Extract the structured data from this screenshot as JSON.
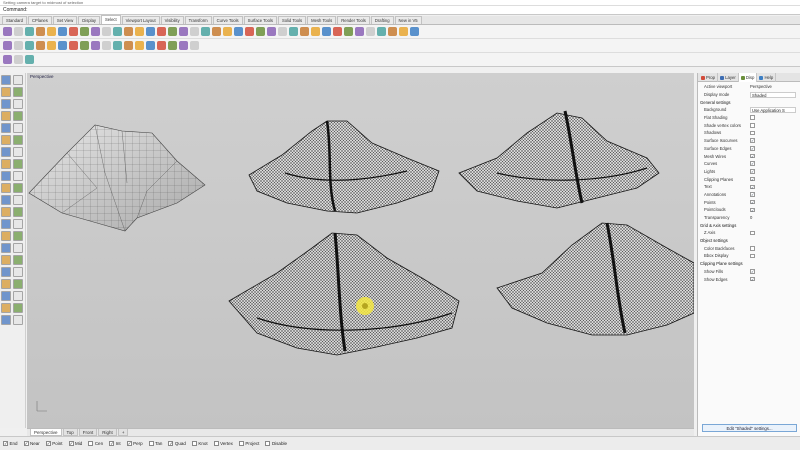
{
  "command": {
    "history": "Setting camera target to midmost of selection",
    "label": "Command:",
    "value": ""
  },
  "tabs": [
    {
      "label": "Standard"
    },
    {
      "label": "CPlanes"
    },
    {
      "label": "Set View"
    },
    {
      "label": "Display"
    },
    {
      "label": "Select",
      "active": true
    },
    {
      "label": "Viewport Layout"
    },
    {
      "label": "Visibility"
    },
    {
      "label": "Transform"
    },
    {
      "label": "Curve Tools"
    },
    {
      "label": "Surface Tools"
    },
    {
      "label": "Solid Tools"
    },
    {
      "label": "Mesh Tools"
    },
    {
      "label": "Render Tools"
    },
    {
      "label": "Drafting"
    },
    {
      "label": "New in V5"
    }
  ],
  "toolbar_icons": {
    "row1": [
      "new-icon",
      "open-icon",
      "save-icon",
      "print-icon",
      "cut-icon",
      "copy-icon",
      "paste-icon",
      "undo-icon",
      "redo-icon",
      "pan-icon",
      "rotate-view-icon",
      "zoom-icon",
      "zoom-window-icon",
      "zoom-extents-icon",
      "zoom-selected-icon",
      "four-views-icon",
      "cplane-icon",
      "perspective-icon",
      "wireframe-icon",
      "shaded-icon",
      "rendered-icon",
      "ghosted-icon",
      "lights-icon",
      "layers-icon",
      "object-properties-icon",
      "select-all-icon",
      "select-none-icon",
      "invert-selection-icon",
      "select-previous-icon",
      "select-curves-icon",
      "select-surfaces-icon",
      "select-polysurfaces-icon",
      "select-meshes-icon",
      "select-points-icon",
      "select-lights-icon",
      "options-icon",
      "grid-icon",
      "help-icon"
    ],
    "row2": [
      "sphere-icon",
      "box-icon",
      "cylinder-icon",
      "cone-icon",
      "torus-icon",
      "extrude-icon",
      "loft-icon",
      "sweep-icon",
      "revolve-icon",
      "network-icon",
      "patch-icon",
      "blend-icon",
      "boolean-union-icon",
      "boolean-difference-icon",
      "mesh-icon",
      "render-icon",
      "material-icon",
      "environment-icon"
    ],
    "row3": [
      "snap-icon",
      "ortho-icon",
      "planar-icon"
    ]
  },
  "left_tools": [
    "select-icon",
    "point-icon",
    "line-icon",
    "polyline-icon",
    "curve-icon",
    "arc-icon",
    "circle-icon",
    "ellipse-icon",
    "rectangle-icon",
    "polygon-icon",
    "fillet-curve-icon",
    "offset-icon",
    "surface-icon",
    "extrude-icon",
    "solid-box-icon",
    "sphere-icon",
    "mesh-icon",
    "boolean-icon",
    "text-icon",
    "dimension-icon",
    "move-icon",
    "copy-icon",
    "rotate-icon",
    "scale-icon",
    "mirror-icon",
    "array-icon",
    "trim-icon",
    "split-icon",
    "join-icon",
    "explode-icon",
    "group-icon",
    "block-icon",
    "analyze-icon",
    "render-icon",
    "layer-icon",
    "properties-icon",
    "snapshot-icon",
    "osnap-icon",
    "history-icon",
    "gumball-icon",
    "cplane-icon",
    "zoom-icon"
  ],
  "viewport": {
    "title": "Perspective",
    "view_tabs": [
      {
        "label": "Perspective",
        "active": true
      },
      {
        "label": "Top"
      },
      {
        "label": "Front"
      },
      {
        "label": "Right"
      },
      {
        "label": "+"
      }
    ]
  },
  "osnaps": [
    {
      "label": "End",
      "checked": true
    },
    {
      "label": "Near",
      "checked": true
    },
    {
      "label": "Point",
      "checked": true
    },
    {
      "label": "Mid",
      "checked": true
    },
    {
      "label": "Cen",
      "checked": false
    },
    {
      "label": "Int",
      "checked": true
    },
    {
      "label": "Perp",
      "checked": true
    },
    {
      "label": "Tan",
      "checked": false
    },
    {
      "label": "Quad",
      "checked": true
    },
    {
      "label": "Knot",
      "checked": false
    },
    {
      "label": "Vertex",
      "checked": false
    },
    {
      "label": "Project",
      "checked": false
    },
    {
      "label": "Disable",
      "checked": false
    }
  ],
  "panel": {
    "tabs": [
      {
        "label": "Prop",
        "color": "#d24b3a"
      },
      {
        "label": "Layer",
        "color": "#3d6db3"
      },
      {
        "label": "Disp",
        "color": "#6a8f3a",
        "active": true
      },
      {
        "label": "Help",
        "color": "#3d7fc4"
      }
    ],
    "rows": [
      {
        "type": "kv",
        "k": "Active viewport",
        "v": "Perspective"
      },
      {
        "type": "kvbox",
        "k": "Display mode",
        "v": "Shaded"
      },
      {
        "type": "section",
        "k": "General settings"
      },
      {
        "type": "kvbox",
        "k": "Background",
        "v": "Use Application S"
      },
      {
        "type": "cb",
        "k": "Flat Shading",
        "checked": false
      },
      {
        "type": "cb",
        "k": "Shade vertex colors",
        "checked": false
      },
      {
        "type": "cb",
        "k": "Shadows",
        "checked": false
      },
      {
        "type": "cb",
        "k": "Surface Isocurves",
        "checked": true
      },
      {
        "type": "cb",
        "k": "Surface Edges",
        "checked": true
      },
      {
        "type": "cb",
        "k": "Mesh Wires",
        "checked": true
      },
      {
        "type": "cb",
        "k": "Curves",
        "checked": true
      },
      {
        "type": "cb",
        "k": "Lights",
        "checked": true
      },
      {
        "type": "cb",
        "k": "Clipping Planes",
        "checked": true
      },
      {
        "type": "cb",
        "k": "Text",
        "checked": true
      },
      {
        "type": "cb",
        "k": "Annotations",
        "checked": true
      },
      {
        "type": "cb",
        "k": "Points",
        "checked": true
      },
      {
        "type": "cb",
        "k": "Pointclouds",
        "checked": true
      },
      {
        "type": "kv",
        "k": "Transparency",
        "v": "0"
      },
      {
        "type": "section",
        "k": "Grid & Axis settings"
      },
      {
        "type": "cb",
        "k": "Z Axis",
        "checked": false
      },
      {
        "type": "section",
        "k": "Object settings"
      },
      {
        "type": "cb",
        "k": "Color Backfaces",
        "checked": false
      },
      {
        "type": "cb",
        "k": "Bbox Display",
        "checked": false
      },
      {
        "type": "section",
        "k": "Clipping Plane settings"
      },
      {
        "type": "cb",
        "k": "Show Fills",
        "checked": true
      },
      {
        "type": "cb",
        "k": "Show Edges",
        "checked": true
      }
    ],
    "edit_button": "Edit \"Shaded\" settings..."
  },
  "colors": {
    "viewport_bg": "#c8c8c8",
    "cursor_highlight": "#f5e742",
    "mesh_fill": "#d4d4d4",
    "mesh_stroke": "#1a1a1a"
  }
}
